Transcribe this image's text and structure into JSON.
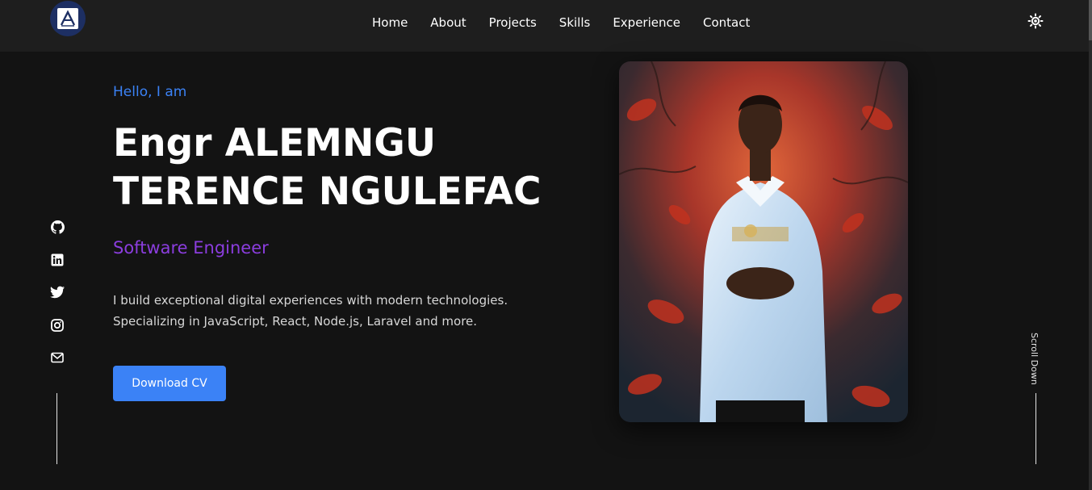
{
  "nav": {
    "links": [
      "Home",
      "About",
      "Projects",
      "Skills",
      "Experience",
      "Contact"
    ],
    "theme_icon": "sun-icon",
    "logo_icon": "brand-logo-icon"
  },
  "social_icons": [
    "github-icon",
    "linkedin-icon",
    "twitter-icon",
    "instagram-icon",
    "mail-icon"
  ],
  "hero": {
    "greeting": "Hello, I am",
    "name": "Engr ALEMNGU TERENCE NGULEFAC",
    "role": "Software Engineer",
    "description": "I build exceptional digital experiences with modern technologies. Specializing in JavaScript, React, Node.js, Laravel and more.",
    "cta_label": "Download CV"
  },
  "scroll_hint": "Scroll Down",
  "colors": {
    "accent_blue": "#3b82f6",
    "accent_purple": "#8b3dde",
    "background": "#131313",
    "navbar": "#1e1e1e"
  }
}
